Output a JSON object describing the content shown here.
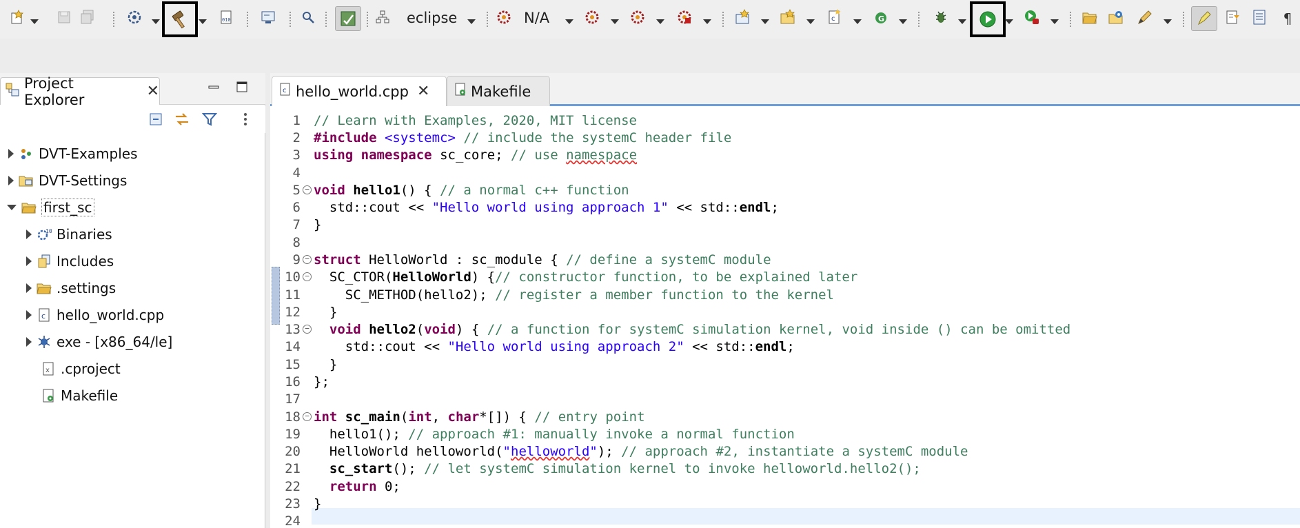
{
  "toolbar": {
    "launch_config": "eclipse",
    "launch_target": "N/A"
  },
  "explorer": {
    "tab_label": "Project Explorer",
    "tree": [
      {
        "label": "DVT-Examples",
        "level": 0,
        "expanded": false
      },
      {
        "label": "DVT-Settings",
        "level": 0,
        "expanded": false
      },
      {
        "label": "first_sc",
        "level": 0,
        "expanded": true
      },
      {
        "label": "Binaries",
        "level": 1,
        "expanded": false
      },
      {
        "label": "Includes",
        "level": 1,
        "expanded": false
      },
      {
        "label": ".settings",
        "level": 1,
        "expanded": false
      },
      {
        "label": "hello_world.cpp",
        "level": 1,
        "expanded": false
      },
      {
        "label": "exe - [x86_64/le]",
        "level": 1,
        "expanded": false
      },
      {
        "label": ".cproject",
        "level": 1,
        "expanded": null
      },
      {
        "label": "Makefile",
        "level": 1,
        "expanded": null
      }
    ]
  },
  "editor": {
    "tabs": [
      {
        "label": "hello_world.cpp",
        "active": true
      },
      {
        "label": "Makefile",
        "active": false
      }
    ],
    "line_numbers": [
      "1",
      "2",
      "3",
      "4",
      "5",
      "6",
      "7",
      "8",
      "9",
      "10",
      "11",
      "12",
      "13",
      "14",
      "15",
      "16",
      "17",
      "18",
      "19",
      "20",
      "21",
      "22",
      "23",
      "24"
    ],
    "code": {
      "l1": "// Learn with Examples, 2020, MIT license",
      "l2_kw": "#include",
      "l2_inc": "<systemc>",
      "l2_cm": "// include the systemC header file",
      "l3_kw1": "using",
      "l3_kw2": "namespace",
      "l3_rest": "sc_core;",
      "l3_cm_pre": "// use ",
      "l3_cm_word": "namespace",
      "l5_kw": "void",
      "l5_fn": "hello1",
      "l5_rest": "() {",
      "l5_cm": "// a normal c++ function",
      "l6_pre": "  std::cout << ",
      "l6_str": "\"Hello world using approach 1\"",
      "l6_mid": " << std::",
      "l6_endl": "endl",
      "l6_end": ";",
      "l7": "}",
      "l9_kw": "struct",
      "l9_rest": "HelloWorld : sc_module {",
      "l9_cm": "// define a systemC module",
      "l10_pre": "  SC_CTOR(",
      "l10_bold": "HelloWorld",
      "l10_mid": ") {",
      "l10_cm": "// constructor function, to be explained later",
      "l11_pre": "    SC_METHOD(hello2); ",
      "l11_cm": "// register a member function to the kernel",
      "l12": "  }",
      "l13_kw": "void",
      "l13_fn": "hello2",
      "l13_p1": "(",
      "l13_kw2": "void",
      "l13_p2": ") { ",
      "l13_cm": "// a function for systemC simulation kernel, void inside () can be omitted",
      "l14_pre": "    std::cout << ",
      "l14_str": "\"Hello world using approach 2\"",
      "l14_mid": " << std::",
      "l14_endl": "endl",
      "l14_end": ";",
      "l15": "  }",
      "l16": "};",
      "l18_kw": "int",
      "l18_fn": "sc_main",
      "l18_p1": "(",
      "l18_kw2": "int",
      "l18_p2": ", ",
      "l18_kw3": "char",
      "l18_p3": "*[]) { ",
      "l18_cm": "// entry point",
      "l19_pre": "  hello1(); ",
      "l19_cm": "// approach #1: manually invoke a normal function",
      "l20_pre": "  HelloWorld helloworld(",
      "l20_q1": "\"",
      "l20_strw": "helloworld",
      "l20_q2": "\"",
      "l20_mid": "); ",
      "l20_cm": "// approach #2, instantiate a systemC module",
      "l21_pre": "  ",
      "l21_fn": "sc_start",
      "l21_mid": "(); ",
      "l21_cm": "// let systemC simulation kernel to invoke helloworld.hello2();",
      "l22_pre": "  ",
      "l22_kw": "return",
      "l22_rest": " 0;",
      "l23": "}"
    }
  },
  "colors": {
    "keyword": "#7f0055",
    "comment": "#3f7f5f",
    "string": "#2a00ff",
    "run_green": "#2e9e3e",
    "highlight_outline": "#000000",
    "tab_accent": "#6b9ed8"
  }
}
